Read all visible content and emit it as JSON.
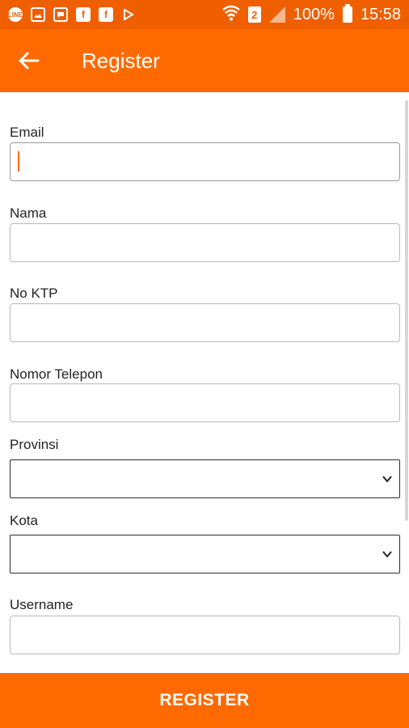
{
  "status_bar": {
    "battery": "100%",
    "time": "15:58",
    "sim_number": "2",
    "icons_left": [
      "line-icon",
      "image-icon",
      "message-icon",
      "facebook-icon",
      "facebook-icon",
      "play-store-icon"
    ],
    "icons_right": [
      "wifi-icon",
      "sim-icon",
      "signal-icon",
      "battery-icon"
    ]
  },
  "app_bar": {
    "title": "Register",
    "back_icon": "arrow-left-icon",
    "background": "#ff6a00"
  },
  "form": {
    "email": {
      "label": "Email",
      "value": "",
      "placeholder": ""
    },
    "nama": {
      "label": "Nama",
      "value": "",
      "placeholder": ""
    },
    "no_ktp": {
      "label": "No KTP",
      "value": "",
      "placeholder": ""
    },
    "nomor_telepon": {
      "label": "Nomor Telepon",
      "value": "",
      "placeholder": ""
    },
    "provinsi": {
      "label": "Provinsi",
      "selected": ""
    },
    "kota": {
      "label": "Kota",
      "selected": ""
    },
    "username": {
      "label": "Username",
      "value": "",
      "placeholder": ""
    }
  },
  "register_button": {
    "label": "REGISTER"
  },
  "colors": {
    "accent": "#ff6a00",
    "status_bar": "#ef5f00"
  }
}
